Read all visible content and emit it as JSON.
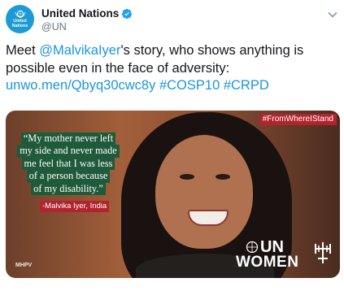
{
  "account": {
    "display_name": "United Nations",
    "handle": "@UN",
    "avatar_text": "United\nNations",
    "verified": true
  },
  "tweet": {
    "text_prefix": "Meet ",
    "mention": "@MalvikaIyer",
    "text_after_mention": "'s story, who shows anything is possible even in the face of adversity: ",
    "link": "unwo.men/Qbyq30cwc8y",
    "hashtags": [
      "#COSP10",
      "#CRPD"
    ]
  },
  "image": {
    "quote_lines": [
      "“My mother never left",
      "my side and never made",
      "me feel that I was less",
      "of a person because",
      "of my disability.”"
    ],
    "attribution": "-Malvika Iyer, India",
    "tag": "#FromWhereIStand",
    "watermark": "MHPV",
    "logo_top": "UN",
    "logo_bottom": "WOMEN"
  },
  "colors": {
    "link_blue": "#1b95e0",
    "quote_green": "#1f5a3a",
    "badge_red": "#b3232d",
    "avatar_blue": "#1b9ad6"
  },
  "icons": {
    "verified": "verified-badge-icon",
    "menu": "chevron-down-icon",
    "avatar_emblem": "un-emblem-icon"
  }
}
